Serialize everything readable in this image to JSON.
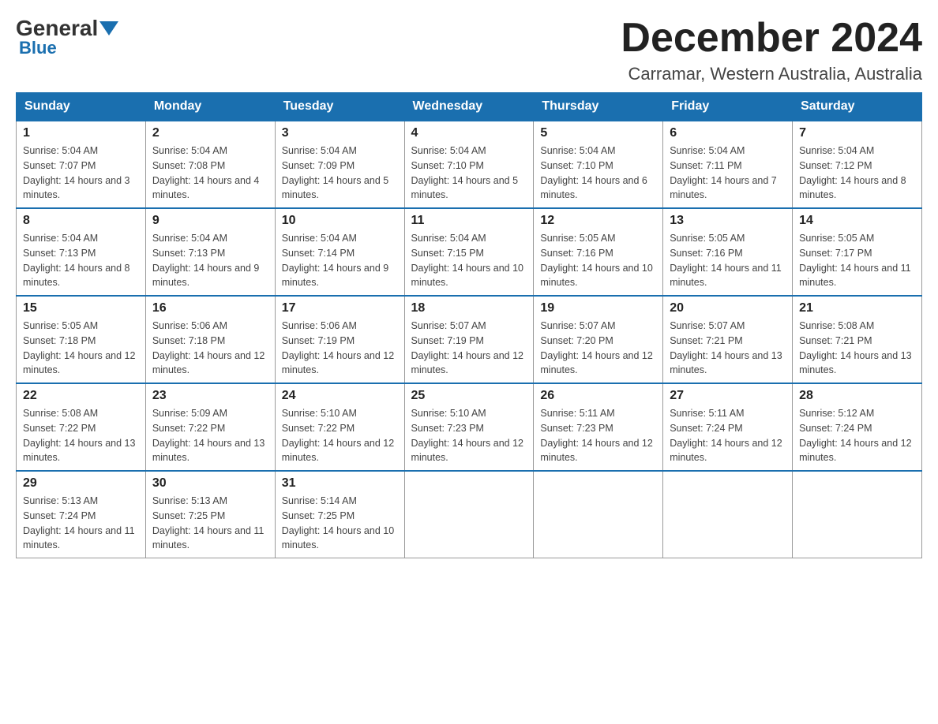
{
  "header": {
    "logo": {
      "general": "General",
      "blue": "Blue"
    },
    "title": "December 2024",
    "location": "Carramar, Western Australia, Australia"
  },
  "days_of_week": [
    "Sunday",
    "Monday",
    "Tuesday",
    "Wednesday",
    "Thursday",
    "Friday",
    "Saturday"
  ],
  "weeks": [
    [
      {
        "day": "1",
        "sunrise": "5:04 AM",
        "sunset": "7:07 PM",
        "daylight": "14 hours and 3 minutes."
      },
      {
        "day": "2",
        "sunrise": "5:04 AM",
        "sunset": "7:08 PM",
        "daylight": "14 hours and 4 minutes."
      },
      {
        "day": "3",
        "sunrise": "5:04 AM",
        "sunset": "7:09 PM",
        "daylight": "14 hours and 5 minutes."
      },
      {
        "day": "4",
        "sunrise": "5:04 AM",
        "sunset": "7:10 PM",
        "daylight": "14 hours and 5 minutes."
      },
      {
        "day": "5",
        "sunrise": "5:04 AM",
        "sunset": "7:10 PM",
        "daylight": "14 hours and 6 minutes."
      },
      {
        "day": "6",
        "sunrise": "5:04 AM",
        "sunset": "7:11 PM",
        "daylight": "14 hours and 7 minutes."
      },
      {
        "day": "7",
        "sunrise": "5:04 AM",
        "sunset": "7:12 PM",
        "daylight": "14 hours and 8 minutes."
      }
    ],
    [
      {
        "day": "8",
        "sunrise": "5:04 AM",
        "sunset": "7:13 PM",
        "daylight": "14 hours and 8 minutes."
      },
      {
        "day": "9",
        "sunrise": "5:04 AM",
        "sunset": "7:13 PM",
        "daylight": "14 hours and 9 minutes."
      },
      {
        "day": "10",
        "sunrise": "5:04 AM",
        "sunset": "7:14 PM",
        "daylight": "14 hours and 9 minutes."
      },
      {
        "day": "11",
        "sunrise": "5:04 AM",
        "sunset": "7:15 PM",
        "daylight": "14 hours and 10 minutes."
      },
      {
        "day": "12",
        "sunrise": "5:05 AM",
        "sunset": "7:16 PM",
        "daylight": "14 hours and 10 minutes."
      },
      {
        "day": "13",
        "sunrise": "5:05 AM",
        "sunset": "7:16 PM",
        "daylight": "14 hours and 11 minutes."
      },
      {
        "day": "14",
        "sunrise": "5:05 AM",
        "sunset": "7:17 PM",
        "daylight": "14 hours and 11 minutes."
      }
    ],
    [
      {
        "day": "15",
        "sunrise": "5:05 AM",
        "sunset": "7:18 PM",
        "daylight": "14 hours and 12 minutes."
      },
      {
        "day": "16",
        "sunrise": "5:06 AM",
        "sunset": "7:18 PM",
        "daylight": "14 hours and 12 minutes."
      },
      {
        "day": "17",
        "sunrise": "5:06 AM",
        "sunset": "7:19 PM",
        "daylight": "14 hours and 12 minutes."
      },
      {
        "day": "18",
        "sunrise": "5:07 AM",
        "sunset": "7:19 PM",
        "daylight": "14 hours and 12 minutes."
      },
      {
        "day": "19",
        "sunrise": "5:07 AM",
        "sunset": "7:20 PM",
        "daylight": "14 hours and 12 minutes."
      },
      {
        "day": "20",
        "sunrise": "5:07 AM",
        "sunset": "7:21 PM",
        "daylight": "14 hours and 13 minutes."
      },
      {
        "day": "21",
        "sunrise": "5:08 AM",
        "sunset": "7:21 PM",
        "daylight": "14 hours and 13 minutes."
      }
    ],
    [
      {
        "day": "22",
        "sunrise": "5:08 AM",
        "sunset": "7:22 PM",
        "daylight": "14 hours and 13 minutes."
      },
      {
        "day": "23",
        "sunrise": "5:09 AM",
        "sunset": "7:22 PM",
        "daylight": "14 hours and 13 minutes."
      },
      {
        "day": "24",
        "sunrise": "5:10 AM",
        "sunset": "7:22 PM",
        "daylight": "14 hours and 12 minutes."
      },
      {
        "day": "25",
        "sunrise": "5:10 AM",
        "sunset": "7:23 PM",
        "daylight": "14 hours and 12 minutes."
      },
      {
        "day": "26",
        "sunrise": "5:11 AM",
        "sunset": "7:23 PM",
        "daylight": "14 hours and 12 minutes."
      },
      {
        "day": "27",
        "sunrise": "5:11 AM",
        "sunset": "7:24 PM",
        "daylight": "14 hours and 12 minutes."
      },
      {
        "day": "28",
        "sunrise": "5:12 AM",
        "sunset": "7:24 PM",
        "daylight": "14 hours and 12 minutes."
      }
    ],
    [
      {
        "day": "29",
        "sunrise": "5:13 AM",
        "sunset": "7:24 PM",
        "daylight": "14 hours and 11 minutes."
      },
      {
        "day": "30",
        "sunrise": "5:13 AM",
        "sunset": "7:25 PM",
        "daylight": "14 hours and 11 minutes."
      },
      {
        "day": "31",
        "sunrise": "5:14 AM",
        "sunset": "7:25 PM",
        "daylight": "14 hours and 10 minutes."
      },
      null,
      null,
      null,
      null
    ]
  ]
}
